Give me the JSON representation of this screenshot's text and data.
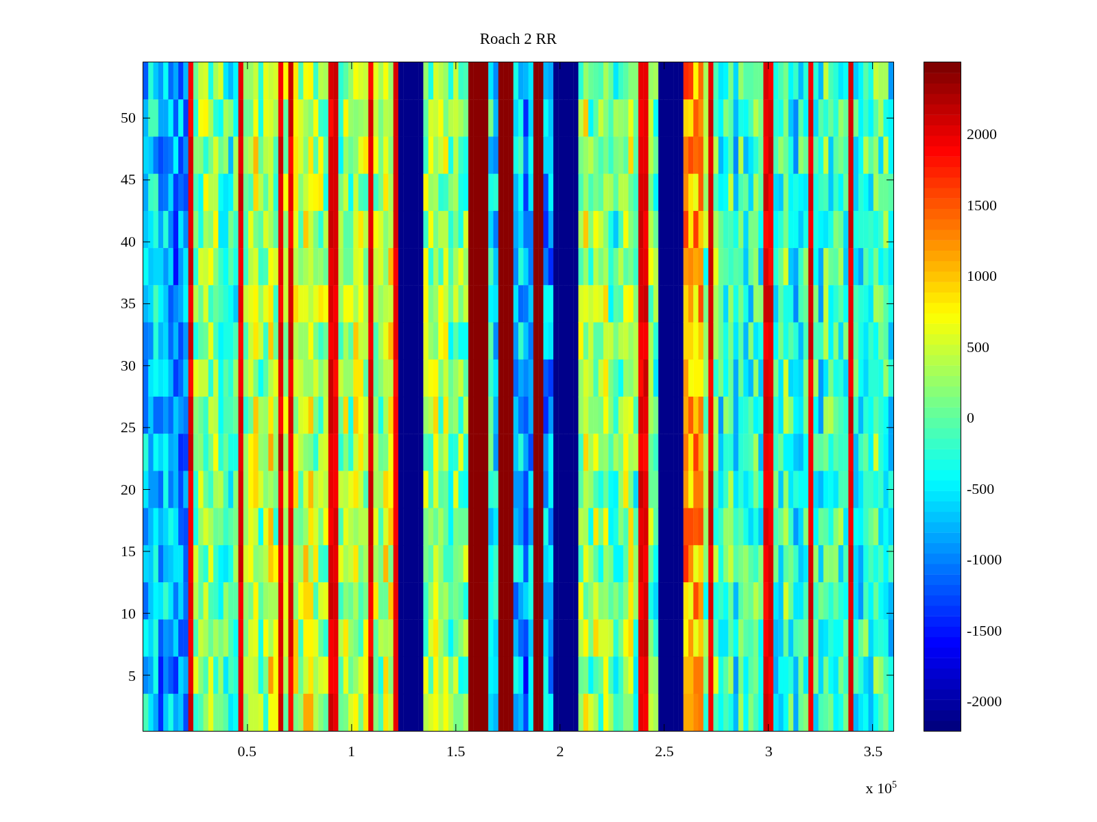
{
  "title": "Roach 2 RR",
  "x_axis": {
    "ticks": [
      "0.5",
      "1",
      "1.5",
      "2",
      "2.5",
      "3",
      "3.5"
    ],
    "exponent_label": "x 10$^{5}$"
  },
  "y_axis": {
    "ticks": [
      "50",
      "45",
      "40",
      "35",
      "30",
      "25",
      "20",
      "15",
      "10",
      "5"
    ]
  },
  "colorbar": {
    "ticks": [
      "2000",
      "1500",
      "1000",
      "500",
      "0",
      "-500",
      "-1000",
      "-1500",
      "-2000"
    ]
  }
}
